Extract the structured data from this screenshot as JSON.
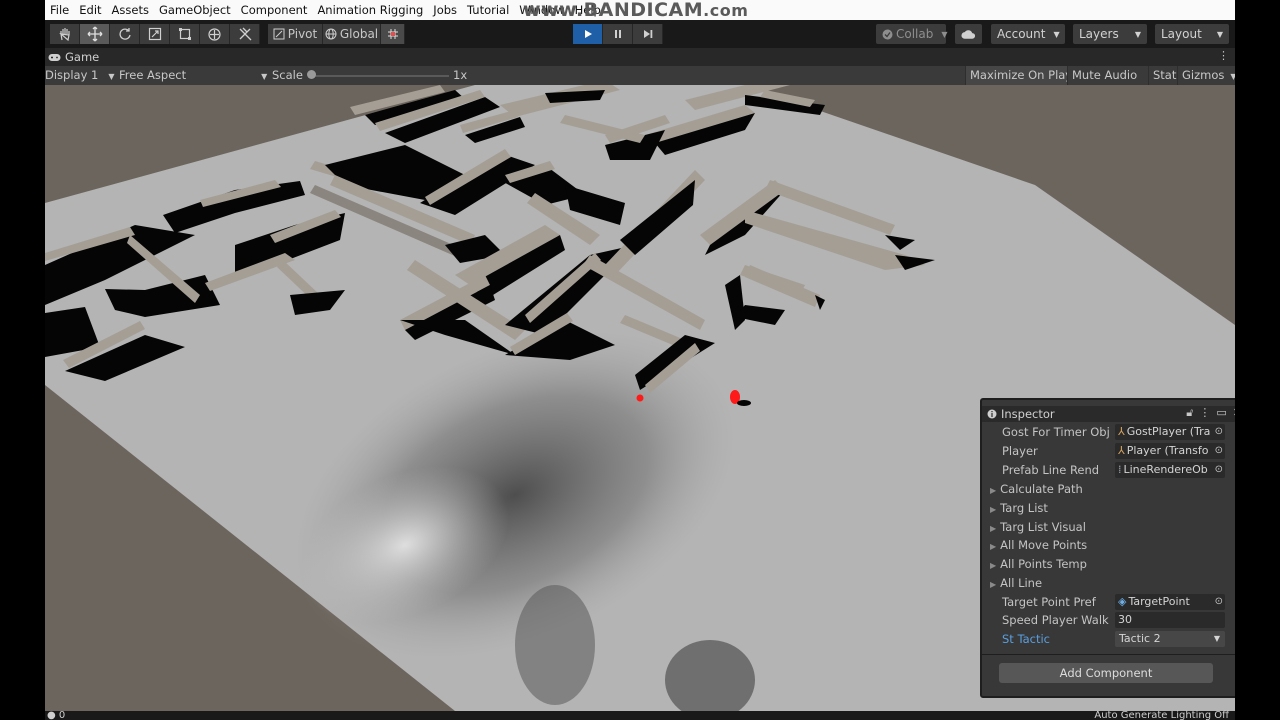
{
  "menu": [
    "File",
    "Edit",
    "Assets",
    "GameObject",
    "Component",
    "Animation Rigging",
    "Jobs",
    "Tutorial",
    "Window",
    "Help"
  ],
  "watermark": {
    "main": "www.BANDICAM",
    "suffix": ".com"
  },
  "toolbar": {
    "tools": [
      "hand-tool",
      "move-tool",
      "rotate-tool",
      "scale-tool",
      "rect-tool",
      "transform-tool",
      "custom-tool"
    ],
    "pivot_label": "Pivot",
    "global_label": "Global",
    "collab_label": "Collab",
    "account_label": "Account",
    "layers_label": "Layers",
    "layout_label": "Layout"
  },
  "game_tab": {
    "title": "Game"
  },
  "game_toolbar": {
    "display": "Display 1",
    "aspect": "Free Aspect",
    "scale_label": "Scale",
    "scale_value": "1x",
    "maximize": "Maximize On Play",
    "mute": "Mute Audio",
    "stats": "Stats",
    "gizmos": "Gizmos"
  },
  "inspector": {
    "title": "Inspector",
    "rows": [
      {
        "label": "Gost For Timer Obj",
        "value": "GostPlayer (Tra",
        "icon": "transform-icon"
      },
      {
        "label": "Player",
        "value": "Player (Transfo",
        "icon": "transform-icon"
      },
      {
        "label": "Prefab Line Rend",
        "value": "LineRendereOb",
        "icon": "line-renderer-icon"
      }
    ],
    "foldouts": [
      "Calculate Path",
      "Targ List",
      "Targ List Visual",
      "All Move Points",
      "All Points Temp",
      "All Line"
    ],
    "target_point_pref": {
      "label": "Target Point Pref",
      "value": "TargetPoint"
    },
    "speed": {
      "label": "Speed Player Walk",
      "value": "30"
    },
    "tactic": {
      "label": "St Tactic",
      "value": "Tactic 2"
    },
    "add_component": "Add Component"
  },
  "status": {
    "left": "0",
    "right": "Auto Generate Lighting Off"
  },
  "colors": {
    "accent": "#1f5fa8",
    "ground": "#b4b4b4",
    "wall_top": "#a49e95",
    "shadow": "#050505",
    "background": "#6c655d",
    "marker": "#ff1a1a"
  }
}
